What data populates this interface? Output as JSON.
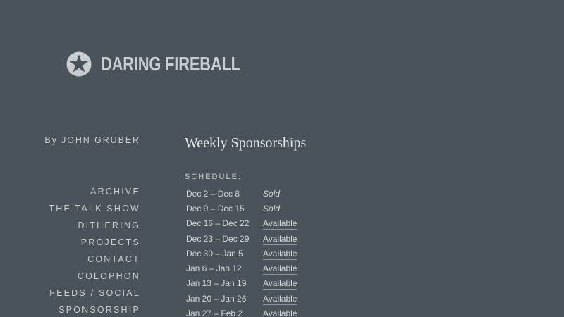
{
  "site": {
    "logo_text": "DARING FIREBALL",
    "logo_icon": "star-badge-icon"
  },
  "byline": {
    "prefix": "By",
    "author": "JOHN GRUBER"
  },
  "nav": {
    "items": [
      {
        "label": "ARCHIVE"
      },
      {
        "label": "THE TALK SHOW"
      },
      {
        "label": "DITHERING"
      },
      {
        "label": "PROJECTS"
      },
      {
        "label": "CONTACT"
      },
      {
        "label": "COLOPHON"
      },
      {
        "label": "FEEDS / SOCIAL"
      },
      {
        "label": "SPONSORSHIP"
      }
    ]
  },
  "main": {
    "heading": "Weekly Sponsorships",
    "schedule_label": "SCHEDULE:",
    "schedule": [
      {
        "week": "Dec 2 – Dec 8",
        "status": "Sold"
      },
      {
        "week": "Dec 9 – Dec 15",
        "status": "Sold"
      },
      {
        "week": "Dec 16 – Dec 22",
        "status": "Available"
      },
      {
        "week": "Dec 23 – Dec 29",
        "status": "Available"
      },
      {
        "week": "Dec 30 – Jan 5",
        "status": "Available"
      },
      {
        "week": "Jan 6 – Jan 12",
        "status": "Available"
      },
      {
        "week": "Jan 13 – Jan 19",
        "status": "Available"
      },
      {
        "week": "Jan 20 – Jan 26",
        "status": "Available"
      },
      {
        "week": "Jan 27 – Feb 2",
        "status": "Available"
      }
    ]
  },
  "colors": {
    "background": "#4a525a",
    "text": "#c9ccd0",
    "heading": "#e4e6e8"
  }
}
